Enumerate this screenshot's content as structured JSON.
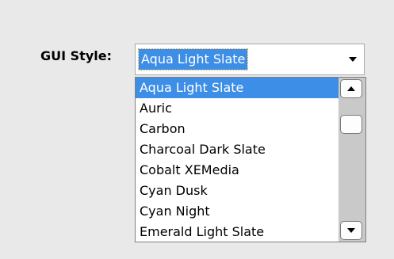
{
  "gui_style": {
    "label": "GUI Style:",
    "selected_value": "Aqua Light Slate",
    "options": [
      "Aqua Light Slate",
      "Auric",
      "Carbon",
      "Charcoal Dark Slate",
      "Cobalt XEMedia",
      "Cyan Dusk",
      "Cyan Night",
      "Emerald Light Slate"
    ],
    "highlighted_option": "Aqua Light Slate"
  },
  "colors": {
    "selection": "#3d8ee6",
    "background": "#e9e9e9",
    "scrollbar_track": "#c9c9c9"
  },
  "icons": {
    "combo_arrow": "triangle-down-icon",
    "scroll_up": "triangle-up-icon",
    "scroll_down": "triangle-down-icon"
  }
}
